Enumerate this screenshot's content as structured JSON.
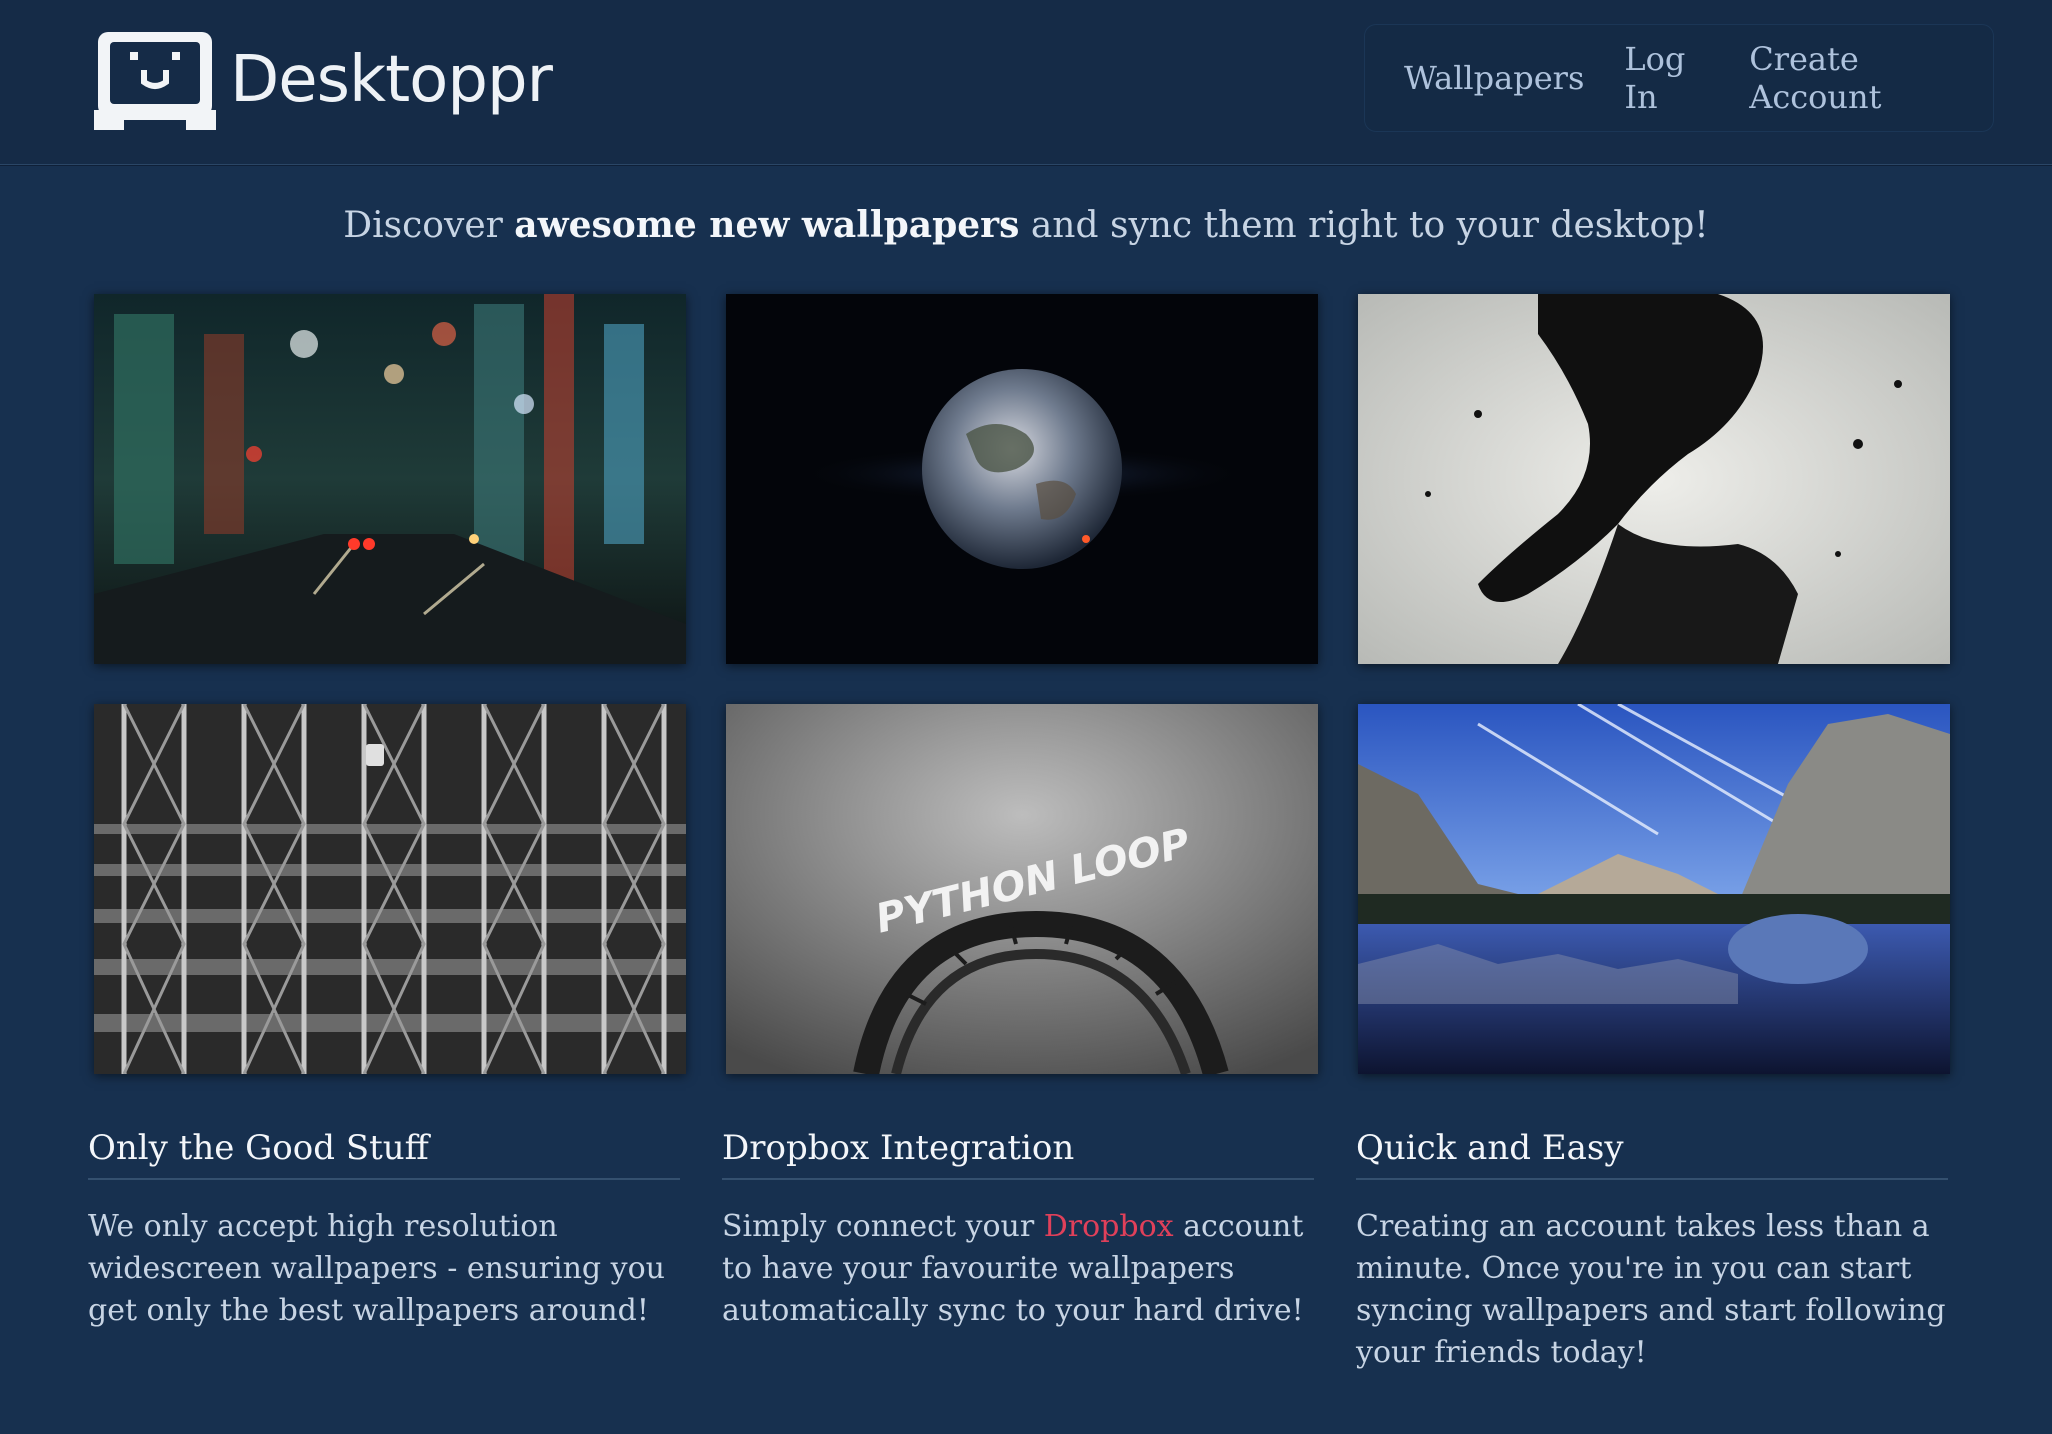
{
  "brand": {
    "name": "Desktoppr",
    "logo_icon": "desktoppr-monitor-face-icon"
  },
  "nav": {
    "items": [
      "Wallpapers",
      "Log In",
      "Create Account"
    ]
  },
  "tagline": {
    "prefix": "Discover ",
    "emphasis": "awesome new wallpapers",
    "suffix": " and sync them right to your desktop!"
  },
  "wallpapers": [
    {
      "subject": "city-street-night"
    },
    {
      "subject": "earth-in-space"
    },
    {
      "subject": "ink-silhouette-portrait"
    },
    {
      "subject": "metal-gate-stairs"
    },
    {
      "subject": "python-loop-rollercoaster",
      "sign_text": "PYTHON LOOP"
    },
    {
      "subject": "yosemite-lake-reflection"
    }
  ],
  "features": [
    {
      "title": "Only the Good Stuff",
      "text": "We only accept high resolution widescreen wallpapers - ensuring you get only the best wallpapers around!"
    },
    {
      "title": "Dropbox Integration",
      "text_before": "Simply connect your ",
      "link": "Dropbox",
      "text_after": " account to have your favourite wallpapers automatically sync to your hard drive!"
    },
    {
      "title": "Quick and Easy",
      "text": "Creating an account takes less than a minute. Once you're in you can start syncing wallpapers and start following your friends today!"
    }
  ],
  "colors": {
    "background": "#17304f",
    "header": "#152b47",
    "nav_text": "#aec2dc",
    "link_accent": "#e0405a",
    "heading": "#f3f6fa"
  }
}
